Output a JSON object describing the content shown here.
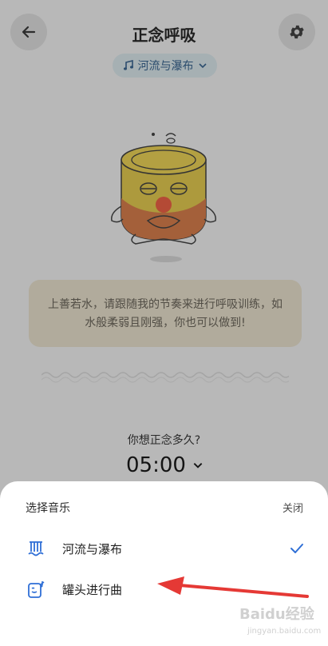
{
  "header": {
    "title": "正念呼吸"
  },
  "music_chip": {
    "label": "河流与瀑布",
    "icon": "music-note-icon"
  },
  "quote": {
    "text": "上善若水，请跟随我的节奏来进行呼吸训练，如水般柔弱且刚强，你也可以做到!"
  },
  "timer": {
    "question": "你想正念多久?",
    "value": "05:00"
  },
  "sheet": {
    "title": "选择音乐",
    "close_label": "关闭",
    "items": [
      {
        "label": "河流与瀑布",
        "icon": "waterfall-icon",
        "selected": true
      },
      {
        "label": "罐头进行曲",
        "icon": "can-music-icon",
        "selected": false
      }
    ]
  },
  "colors": {
    "accent": "#2f6fd6",
    "arrow": "#e53935"
  },
  "watermark": {
    "logo": "Baidu经验",
    "url": "jingyan.baidu.com"
  }
}
